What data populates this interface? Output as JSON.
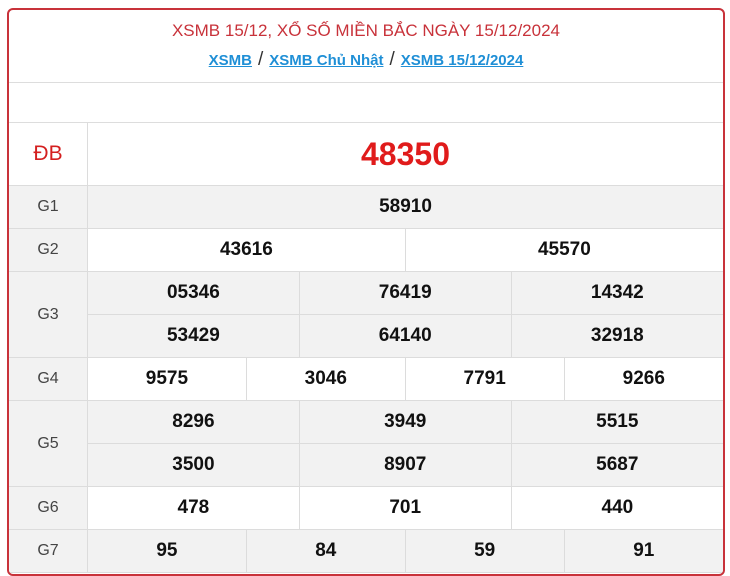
{
  "header": {
    "title": "XSMB 15/12, XỔ SỐ MIỀN BẮC NGÀY 15/12/2024",
    "breadcrumbs": [
      "XSMB",
      "XSMB Chủ Nhật",
      "XSMB 15/12/2024"
    ],
    "separator": "/"
  },
  "results": {
    "db": {
      "label": "ĐB",
      "numbers": [
        "48350"
      ]
    },
    "g1": {
      "label": "G1",
      "numbers": [
        "58910"
      ]
    },
    "g2": {
      "label": "G2",
      "numbers": [
        "43616",
        "45570"
      ]
    },
    "g3": {
      "label": "G3",
      "numbers": [
        "05346",
        "76419",
        "14342",
        "53429",
        "64140",
        "32918"
      ]
    },
    "g4": {
      "label": "G4",
      "numbers": [
        "9575",
        "3046",
        "7791",
        "9266"
      ]
    },
    "g5": {
      "label": "G5",
      "numbers": [
        "8296",
        "3949",
        "5515",
        "3500",
        "8907",
        "5687"
      ]
    },
    "g6": {
      "label": "G6",
      "numbers": [
        "478",
        "701",
        "440"
      ]
    },
    "g7": {
      "label": "G7",
      "numbers": [
        "95",
        "84",
        "59",
        "91"
      ]
    }
  },
  "colors": {
    "accent_red": "#c8323a",
    "special_red": "#e01b1b",
    "link_blue": "#1f8fd6",
    "row_gray": "#f2f2f2"
  }
}
